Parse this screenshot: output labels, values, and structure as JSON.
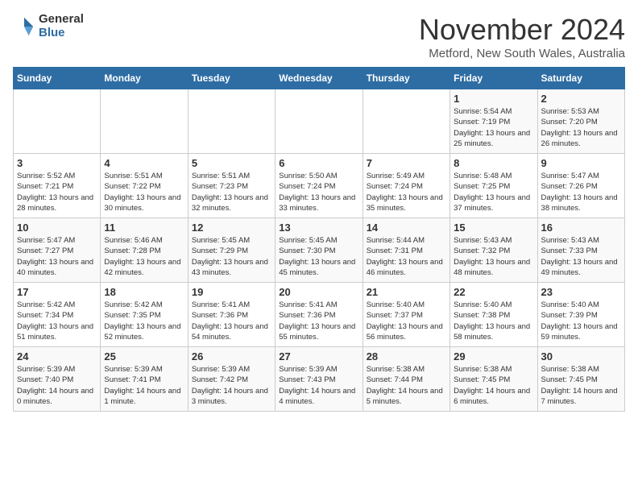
{
  "logo": {
    "general": "General",
    "blue": "Blue"
  },
  "title": "November 2024",
  "location": "Metford, New South Wales, Australia",
  "days_of_week": [
    "Sunday",
    "Monday",
    "Tuesday",
    "Wednesday",
    "Thursday",
    "Friday",
    "Saturday"
  ],
  "weeks": [
    [
      {
        "day": "",
        "info": ""
      },
      {
        "day": "",
        "info": ""
      },
      {
        "day": "",
        "info": ""
      },
      {
        "day": "",
        "info": ""
      },
      {
        "day": "",
        "info": ""
      },
      {
        "day": "1",
        "info": "Sunrise: 5:54 AM\nSunset: 7:19 PM\nDaylight: 13 hours and 25 minutes."
      },
      {
        "day": "2",
        "info": "Sunrise: 5:53 AM\nSunset: 7:20 PM\nDaylight: 13 hours and 26 minutes."
      }
    ],
    [
      {
        "day": "3",
        "info": "Sunrise: 5:52 AM\nSunset: 7:21 PM\nDaylight: 13 hours and 28 minutes."
      },
      {
        "day": "4",
        "info": "Sunrise: 5:51 AM\nSunset: 7:22 PM\nDaylight: 13 hours and 30 minutes."
      },
      {
        "day": "5",
        "info": "Sunrise: 5:51 AM\nSunset: 7:23 PM\nDaylight: 13 hours and 32 minutes."
      },
      {
        "day": "6",
        "info": "Sunrise: 5:50 AM\nSunset: 7:24 PM\nDaylight: 13 hours and 33 minutes."
      },
      {
        "day": "7",
        "info": "Sunrise: 5:49 AM\nSunset: 7:24 PM\nDaylight: 13 hours and 35 minutes."
      },
      {
        "day": "8",
        "info": "Sunrise: 5:48 AM\nSunset: 7:25 PM\nDaylight: 13 hours and 37 minutes."
      },
      {
        "day": "9",
        "info": "Sunrise: 5:47 AM\nSunset: 7:26 PM\nDaylight: 13 hours and 38 minutes."
      }
    ],
    [
      {
        "day": "10",
        "info": "Sunrise: 5:47 AM\nSunset: 7:27 PM\nDaylight: 13 hours and 40 minutes."
      },
      {
        "day": "11",
        "info": "Sunrise: 5:46 AM\nSunset: 7:28 PM\nDaylight: 13 hours and 42 minutes."
      },
      {
        "day": "12",
        "info": "Sunrise: 5:45 AM\nSunset: 7:29 PM\nDaylight: 13 hours and 43 minutes."
      },
      {
        "day": "13",
        "info": "Sunrise: 5:45 AM\nSunset: 7:30 PM\nDaylight: 13 hours and 45 minutes."
      },
      {
        "day": "14",
        "info": "Sunrise: 5:44 AM\nSunset: 7:31 PM\nDaylight: 13 hours and 46 minutes."
      },
      {
        "day": "15",
        "info": "Sunrise: 5:43 AM\nSunset: 7:32 PM\nDaylight: 13 hours and 48 minutes."
      },
      {
        "day": "16",
        "info": "Sunrise: 5:43 AM\nSunset: 7:33 PM\nDaylight: 13 hours and 49 minutes."
      }
    ],
    [
      {
        "day": "17",
        "info": "Sunrise: 5:42 AM\nSunset: 7:34 PM\nDaylight: 13 hours and 51 minutes."
      },
      {
        "day": "18",
        "info": "Sunrise: 5:42 AM\nSunset: 7:35 PM\nDaylight: 13 hours and 52 minutes."
      },
      {
        "day": "19",
        "info": "Sunrise: 5:41 AM\nSunset: 7:36 PM\nDaylight: 13 hours and 54 minutes."
      },
      {
        "day": "20",
        "info": "Sunrise: 5:41 AM\nSunset: 7:36 PM\nDaylight: 13 hours and 55 minutes."
      },
      {
        "day": "21",
        "info": "Sunrise: 5:40 AM\nSunset: 7:37 PM\nDaylight: 13 hours and 56 minutes."
      },
      {
        "day": "22",
        "info": "Sunrise: 5:40 AM\nSunset: 7:38 PM\nDaylight: 13 hours and 58 minutes."
      },
      {
        "day": "23",
        "info": "Sunrise: 5:40 AM\nSunset: 7:39 PM\nDaylight: 13 hours and 59 minutes."
      }
    ],
    [
      {
        "day": "24",
        "info": "Sunrise: 5:39 AM\nSunset: 7:40 PM\nDaylight: 14 hours and 0 minutes."
      },
      {
        "day": "25",
        "info": "Sunrise: 5:39 AM\nSunset: 7:41 PM\nDaylight: 14 hours and 1 minute."
      },
      {
        "day": "26",
        "info": "Sunrise: 5:39 AM\nSunset: 7:42 PM\nDaylight: 14 hours and 3 minutes."
      },
      {
        "day": "27",
        "info": "Sunrise: 5:39 AM\nSunset: 7:43 PM\nDaylight: 14 hours and 4 minutes."
      },
      {
        "day": "28",
        "info": "Sunrise: 5:38 AM\nSunset: 7:44 PM\nDaylight: 14 hours and 5 minutes."
      },
      {
        "day": "29",
        "info": "Sunrise: 5:38 AM\nSunset: 7:45 PM\nDaylight: 14 hours and 6 minutes."
      },
      {
        "day": "30",
        "info": "Sunrise: 5:38 AM\nSunset: 7:45 PM\nDaylight: 14 hours and 7 minutes."
      }
    ]
  ]
}
